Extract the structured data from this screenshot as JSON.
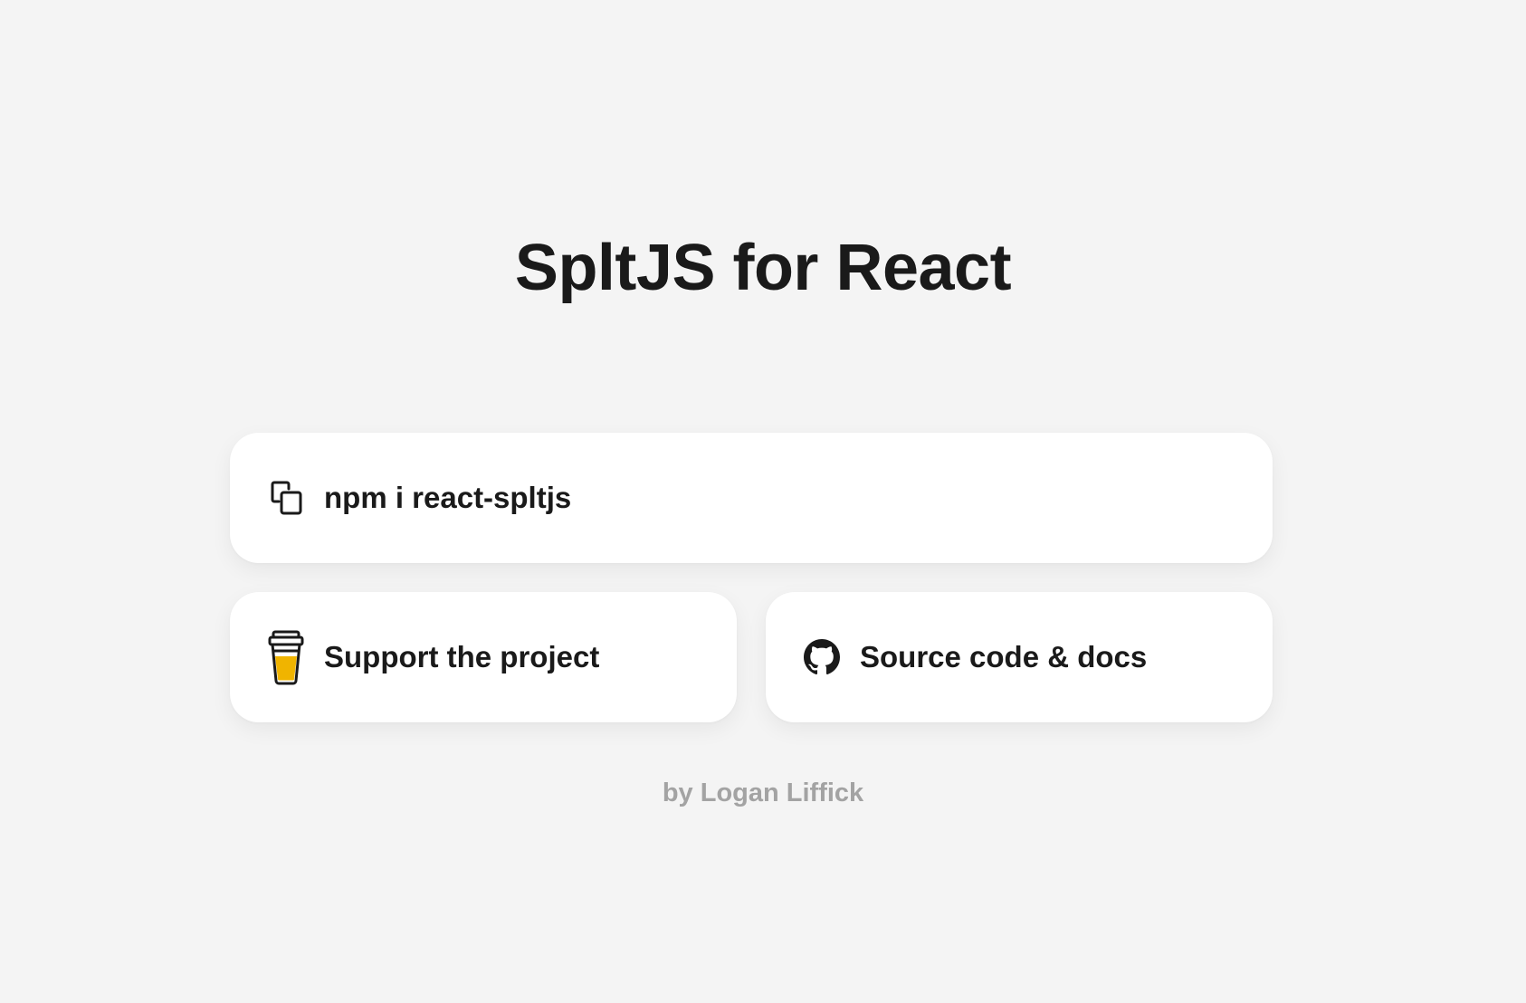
{
  "page": {
    "title": "SpltJS for React",
    "byline": "by Logan Liffick"
  },
  "cards": {
    "install": {
      "label": "npm i react-spltjs",
      "icon": "copy-icon"
    },
    "support": {
      "label": "Support the project",
      "icon": "coffee-cup-icon"
    },
    "source": {
      "label": "Source code & docs",
      "icon": "github-icon"
    }
  },
  "colors": {
    "background": "#f4f4f4",
    "card": "#ffffff",
    "text": "#1a1a1a",
    "muted": "#a3a3a3",
    "coffee": "#f0b400"
  }
}
